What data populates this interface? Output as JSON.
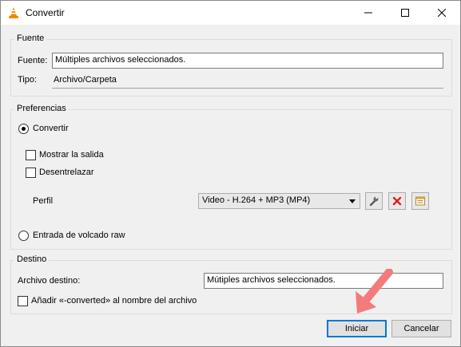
{
  "window": {
    "title": "Convertir",
    "icons": [
      "vlc-cone-icon",
      "minimize-icon",
      "maximize-icon",
      "close-icon"
    ]
  },
  "source": {
    "group_title": "Fuente",
    "source_label": "Fuente:",
    "source_value": "Múltiples archivos seleccionados.",
    "type_label": "Tipo:",
    "type_value": "Archivo/Carpeta"
  },
  "preferences": {
    "group_title": "Preferencias",
    "convert_label": "Convertir",
    "convert_selected": true,
    "show_output_label": "Mostrar la salida",
    "show_output_checked": false,
    "deinterlace_label": "Desentrelazar",
    "deinterlace_checked": false,
    "profile_label": "Perfil",
    "profile_value": "Video - H.264 + MP3 (MP4)",
    "profile_icons": [
      "wrench-icon",
      "delete-icon",
      "new-profile-icon"
    ],
    "raw_dump_label": "Entrada de volcado raw",
    "raw_dump_selected": false
  },
  "destination": {
    "group_title": "Destino",
    "file_label": "Archivo destino:",
    "file_value": "Mútiples archivos seleccionados.",
    "append_label": "Añadir «-converted» al nombre del archivo",
    "append_checked": false
  },
  "buttons": {
    "start_label": "Iniciar",
    "cancel_label": "Cancelar"
  },
  "colors": {
    "accent": "#0078d7",
    "arrow": "#f47b7b",
    "delete": "#e02020"
  }
}
